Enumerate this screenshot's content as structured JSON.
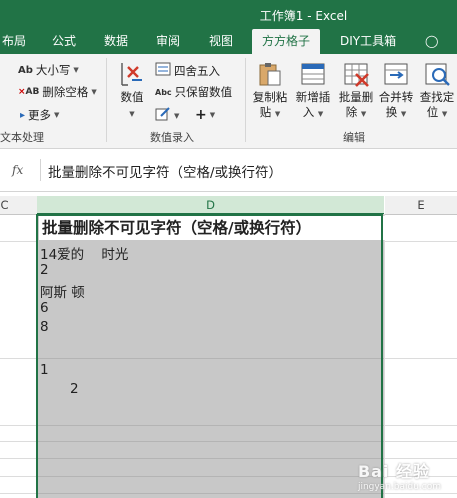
{
  "window": {
    "title": "工作簿1 - Excel"
  },
  "tabs": [
    "布局",
    "公式",
    "数据",
    "审阅",
    "视图",
    "方方格子",
    "DIY工具箱",
    "告诉我"
  ],
  "ribbon": {
    "text_group": {
      "items": [
        "大小写",
        "删除空格",
        "更多"
      ],
      "label": "文本处理"
    },
    "number_group": {
      "value_btn": "数值",
      "round_btn": "四舍五入",
      "keep_btn": "只保留数值",
      "plus_btn": "+",
      "label": "数值录入"
    },
    "edit_group": {
      "buttons": [
        {
          "l1": "复制粘",
          "l2": "贴"
        },
        {
          "l1": "新增插",
          "l2": "入"
        },
        {
          "l1": "批量删",
          "l2": "除"
        },
        {
          "l1": "合并转",
          "l2": "换"
        },
        {
          "l1": "查找定",
          "l2": "位"
        }
      ],
      "label": "编辑"
    }
  },
  "formula_bar": {
    "fx": "fx",
    "content": "批量删除不可见字符（空格/或换行符）"
  },
  "grid": {
    "columns": [
      "C",
      "D",
      "E"
    ],
    "header_text": "批量删除不可见字符（空格/或换行符）",
    "cell_lines_1": [
      "14爱的    时光",
      "2",
      "阿斯 顿",
      "6",
      "8"
    ],
    "cell_lines_2": [
      "1",
      "       2"
    ]
  },
  "watermark": {
    "main": "Bai 经验",
    "sub": "jingyan.baidu.com"
  },
  "colors": {
    "accent": "#217346",
    "selected_fill": "#c8c8c8"
  }
}
